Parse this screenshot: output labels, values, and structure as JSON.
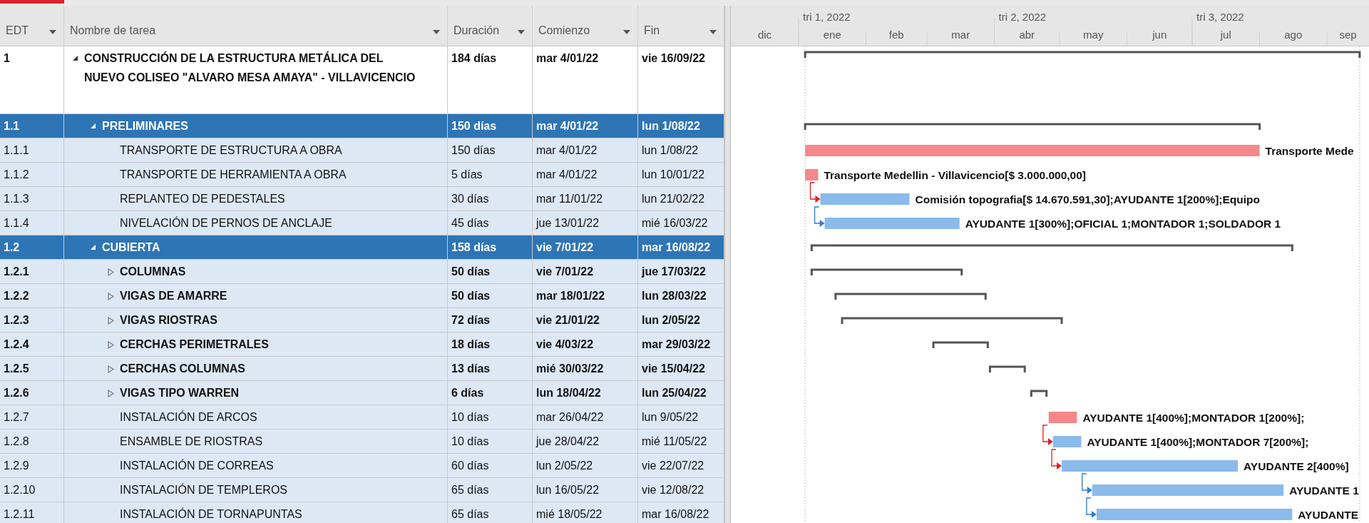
{
  "columns": [
    "EDT",
    "Nombre de tarea",
    "Duración",
    "Comienzo",
    "Fin"
  ],
  "timescale": {
    "quarters": [
      "tri 1, 2022",
      "tri 2, 2022",
      "tri 3, 2022"
    ],
    "months": [
      "dic",
      "ene",
      "feb",
      "mar",
      "abr",
      "may",
      "jun",
      "jul",
      "ago",
      "sep"
    ]
  },
  "tasks": [
    {
      "edt": "1",
      "name": "CONSTRUCCIÓN DE LA ESTRUCTURA METÁLICA DEL NUEVO COLISEO \"ALVARO MESA AMAYA\" - VILLAVICENCIO",
      "duration": "184 días",
      "start": "mar 4/01/22",
      "finish": "vie 16/09/22",
      "kind": "summary",
      "expanded": true,
      "selected": false,
      "highlighted": false,
      "children": [
        {
          "edt": "1.1",
          "name": "PRELIMINARES",
          "duration": "150 días",
          "start": "mar 4/01/22",
          "finish": "lun 1/08/22",
          "kind": "summary",
          "expanded": true,
          "selected": true,
          "children": [
            {
              "edt": "1.1.1",
              "name": "TRANSPORTE DE ESTRUCTURA A OBRA",
              "duration": "150 días",
              "start": "mar 4/01/22",
              "finish": "lun 1/08/22",
              "kind": "task",
              "critical": true,
              "selected": false,
              "highlighted": true,
              "bar_label": "Transporte Mede"
            },
            {
              "edt": "1.1.2",
              "name": "TRANSPORTE DE HERRAMIENTA A OBRA",
              "duration": "5 días",
              "start": "mar 4/01/22",
              "finish": "lun 10/01/22",
              "kind": "task",
              "critical": true,
              "selected": false,
              "highlighted": true,
              "bar_label": "Transporte Medellin - Villavicencio[$ 3.000.000,00]"
            },
            {
              "edt": "1.1.3",
              "name": "REPLANTEO DE PEDESTALES",
              "duration": "30 días",
              "start": "mar 11/01/22",
              "finish": "lun 21/02/22",
              "kind": "task",
              "critical": false,
              "link": {
                "critical": true
              },
              "selected": false,
              "highlighted": true,
              "bar_label": "Comisión topografia[$ 14.670.591,30];AYUDANTE 1[200%];Equipo"
            },
            {
              "edt": "1.1.4",
              "name": "NIVELACIÓN DE PERNOS DE ANCLAJE",
              "duration": "45 días",
              "start": "jue 13/01/22",
              "finish": "mié 16/03/22",
              "kind": "task",
              "critical": false,
              "link": {
                "critical": false
              },
              "selected": false,
              "highlighted": true,
              "bar_label": "AYUDANTE 1[300%];OFICIAL 1;MONTADOR 1;SOLDADOR 1"
            }
          ]
        },
        {
          "edt": "1.2",
          "name": "CUBIERTA",
          "duration": "158 días",
          "start": "vie 7/01/22",
          "finish": "mar 16/08/22",
          "kind": "summary",
          "expanded": true,
          "selected": true,
          "children": [
            {
              "edt": "1.2.1",
              "name": "COLUMNAS",
              "duration": "50 días",
              "start": "vie 7/01/22",
              "finish": "jue 17/03/22",
              "kind": "summary",
              "expanded": false,
              "selected": false,
              "highlighted": true
            },
            {
              "edt": "1.2.2",
              "name": "VIGAS DE AMARRE",
              "duration": "50 días",
              "start": "mar 18/01/22",
              "finish": "lun 28/03/22",
              "kind": "summary",
              "expanded": false,
              "selected": false,
              "highlighted": true
            },
            {
              "edt": "1.2.3",
              "name": "VIGAS RIOSTRAS",
              "duration": "72 días",
              "start": "vie 21/01/22",
              "finish": "lun 2/05/22",
              "kind": "summary",
              "expanded": false,
              "selected": false,
              "highlighted": true
            },
            {
              "edt": "1.2.4",
              "name": "CERCHAS PERIMETRALES",
              "duration": "18 días",
              "start": "vie 4/03/22",
              "finish": "mar 29/03/22",
              "kind": "summary",
              "expanded": false,
              "selected": false,
              "highlighted": true
            },
            {
              "edt": "1.2.5",
              "name": "CERCHAS COLUMNAS",
              "duration": "13 días",
              "start": "mié 30/03/22",
              "finish": "vie 15/04/22",
              "kind": "summary",
              "expanded": false,
              "selected": false,
              "highlighted": true
            },
            {
              "edt": "1.2.6",
              "name": "VIGAS TIPO WARREN",
              "duration": "6 días",
              "start": "lun 18/04/22",
              "finish": "lun 25/04/22",
              "kind": "summary",
              "expanded": false,
              "selected": false,
              "highlighted": true
            },
            {
              "edt": "1.2.7",
              "name": "INSTALACIÓN DE ARCOS",
              "duration": "10 días",
              "start": "mar 26/04/22",
              "finish": "lun 9/05/22",
              "kind": "task",
              "critical": true,
              "selected": false,
              "highlighted": true,
              "bar_label": "AYUDANTE 1[400%];MONTADOR 1[200%];"
            },
            {
              "edt": "1.2.8",
              "name": "ENSAMBLE DE RIOSTRAS",
              "duration": "10 días",
              "start": "jue 28/04/22",
              "finish": "mié 11/05/22",
              "kind": "task",
              "critical": false,
              "link": {
                "critical": true
              },
              "selected": false,
              "highlighted": true,
              "bar_label": "AYUDANTE 1[400%];MONTADOR 7[200%];"
            },
            {
              "edt": "1.2.9",
              "name": "INSTALACIÓN DE CORREAS",
              "duration": "60 días",
              "start": "lun 2/05/22",
              "finish": "vie 22/07/22",
              "kind": "task",
              "critical": false,
              "link": {
                "critical": true
              },
              "selected": false,
              "highlighted": true,
              "bar_label": "AYUDANTE 2[400%]"
            },
            {
              "edt": "1.2.10",
              "name": "INSTALACIÓN DE TEMPLEROS",
              "duration": "65 días",
              "start": "lun 16/05/22",
              "finish": "vie 12/08/22",
              "kind": "task",
              "critical": false,
              "link": {
                "critical": false
              },
              "selected": false,
              "highlighted": true,
              "bar_label": "AYUDANTE 1"
            },
            {
              "edt": "1.2.11",
              "name": "INSTALACIÓN DE TORNAPUNTAS",
              "duration": "65 días",
              "start": "mié 18/05/22",
              "finish": "mar 16/08/22",
              "kind": "task",
              "critical": false,
              "link": {
                "critical": false
              },
              "selected": false,
              "highlighted": true,
              "bar_label": "AYUDANTE"
            }
          ]
        }
      ]
    }
  ]
}
